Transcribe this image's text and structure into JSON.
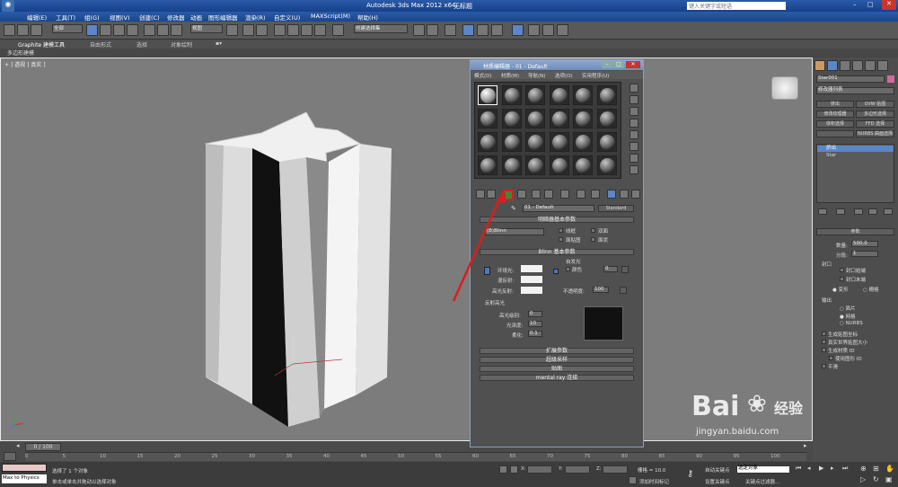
{
  "title": {
    "app": "Autodesk 3ds Max 2012 x64",
    "doc": "无标题",
    "search_placeholder": "键入关键字或短语"
  },
  "menus": [
    "编辑(E)",
    "工具(T)",
    "组(G)",
    "视图(V)",
    "创建(C)",
    "修改器",
    "动画",
    "图形编辑器",
    "渲染(R)",
    "自定义(U)",
    "MAXScript(M)",
    "帮助(H)"
  ],
  "toolbar": {
    "selection_filter": "全部",
    "ref_coord": "视图",
    "named_sel": "创建选择集"
  },
  "ribbon": {
    "tabs": [
      "Graphite 建模工具",
      "自由形式",
      "选择",
      "对象绘制"
    ],
    "sub": "多边形建模"
  },
  "viewport": {
    "label": "+ ] 透视 ] 真实 ]"
  },
  "material_editor": {
    "title": "材质编辑器 - 01 - Default",
    "menus": [
      "模式(D)",
      "材质(M)",
      "导航(N)",
      "选项(O)",
      "实用程序(U)"
    ],
    "material_name": "01 - Default",
    "material_type": "Standard",
    "shader_rollout": "明暗器基本参数",
    "shader": "(B)Blinn",
    "shader_opts": [
      "线框",
      "双面",
      "面贴图",
      "面状"
    ],
    "blinn_rollout": "Blinn 基本参数",
    "self_illum": "自发光",
    "color_label": "颜色",
    "color_value": "0",
    "ambient": "环境光:",
    "diffuse": "漫反射:",
    "specular": "高光反射:",
    "opacity_label": "不透明度:",
    "opacity": "100",
    "spec_highlights": "反射高光",
    "spec_level_label": "高光级别:",
    "spec_level": "0",
    "gloss_label": "光泽度:",
    "gloss": "10",
    "soften_label": "柔化:",
    "soften": "0.1",
    "rollouts": [
      "扩展参数",
      "超级采样",
      "贴图",
      "mental ray 连接"
    ]
  },
  "command_panel": {
    "object_name": "Star001",
    "modifier_list": "修改器列表",
    "buttons": [
      "挤出",
      "UVW 贴图",
      "修改纹理器",
      "多边形选择",
      "体积选择",
      "FFD 选择",
      "",
      "NURBS 曲面选择"
    ],
    "stack": [
      "挤出",
      "Star"
    ],
    "params_title": "参数",
    "amount_label": "数量:",
    "amount": "500.0",
    "segments_label": "分段:",
    "segments": "1",
    "capping": "封口",
    "cap_start": "封口始端",
    "cap_end": "封口末端",
    "morph": "变形",
    "grid": "栅格",
    "output": "输出",
    "out_opts": [
      "面片",
      "网格",
      "NURBS"
    ],
    "gen_map": "生成贴图坐标",
    "real_world": "真实世界贴图大小",
    "gen_mat": "生成材质 ID",
    "use_shape": "使用图形 ID",
    "smooth": "平滑"
  },
  "timeline": {
    "frame": "0 / 100",
    "ticks": [
      "0",
      "5",
      "10",
      "15",
      "20",
      "25",
      "30",
      "35",
      "40",
      "45",
      "50",
      "55",
      "60",
      "65",
      "70",
      "75",
      "80",
      "85",
      "90",
      "95",
      "100"
    ]
  },
  "status": {
    "script": "Max to Physics",
    "msg1": "选择了 1 个对象",
    "msg2": "单击或单击并拖动以选择对象",
    "x": "X:",
    "y": "Y:",
    "z": "Z:",
    "grid": "栅格 = 10.0",
    "auto_key": "自动关键点",
    "sel_obj": "选定对象",
    "set_key": "设置关键点",
    "key_filters": "关键点过滤器...",
    "add_tag": "添加时间标记"
  },
  "watermark": {
    "brand": "Bai",
    "brand2": "经验",
    "url": "jingyan.baidu.com"
  },
  "colors": {
    "accent": "#5b86c7",
    "arrow": "#d81e1e"
  }
}
